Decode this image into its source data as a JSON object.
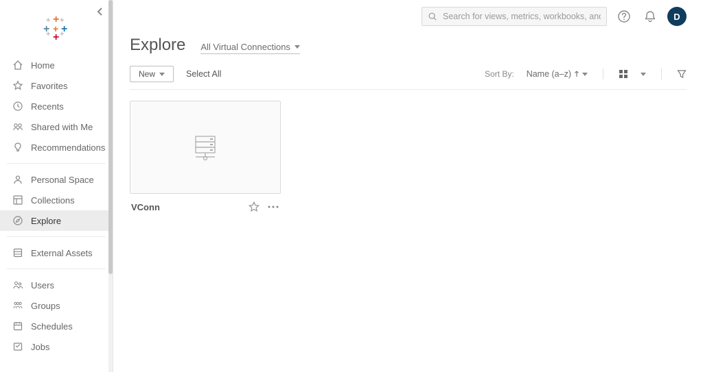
{
  "search": {
    "placeholder": "Search for views, metrics, workbooks, and more"
  },
  "avatar": {
    "initial": "D"
  },
  "sidebar": {
    "items": [
      {
        "label": "Home"
      },
      {
        "label": "Favorites"
      },
      {
        "label": "Recents"
      },
      {
        "label": "Shared with Me"
      },
      {
        "label": "Recommendations"
      },
      {
        "label": "Personal Space"
      },
      {
        "label": "Collections"
      },
      {
        "label": "Explore"
      },
      {
        "label": "External Assets"
      },
      {
        "label": "Users"
      },
      {
        "label": "Groups"
      },
      {
        "label": "Schedules"
      },
      {
        "label": "Jobs"
      }
    ]
  },
  "page": {
    "title": "Explore",
    "type_filter": "All Virtual Connections"
  },
  "toolbar": {
    "new_label": "New",
    "select_all": "Select All",
    "sort_label": "Sort By:",
    "sort_value": "Name (a–z)"
  },
  "items": [
    {
      "title": "VConn"
    }
  ]
}
